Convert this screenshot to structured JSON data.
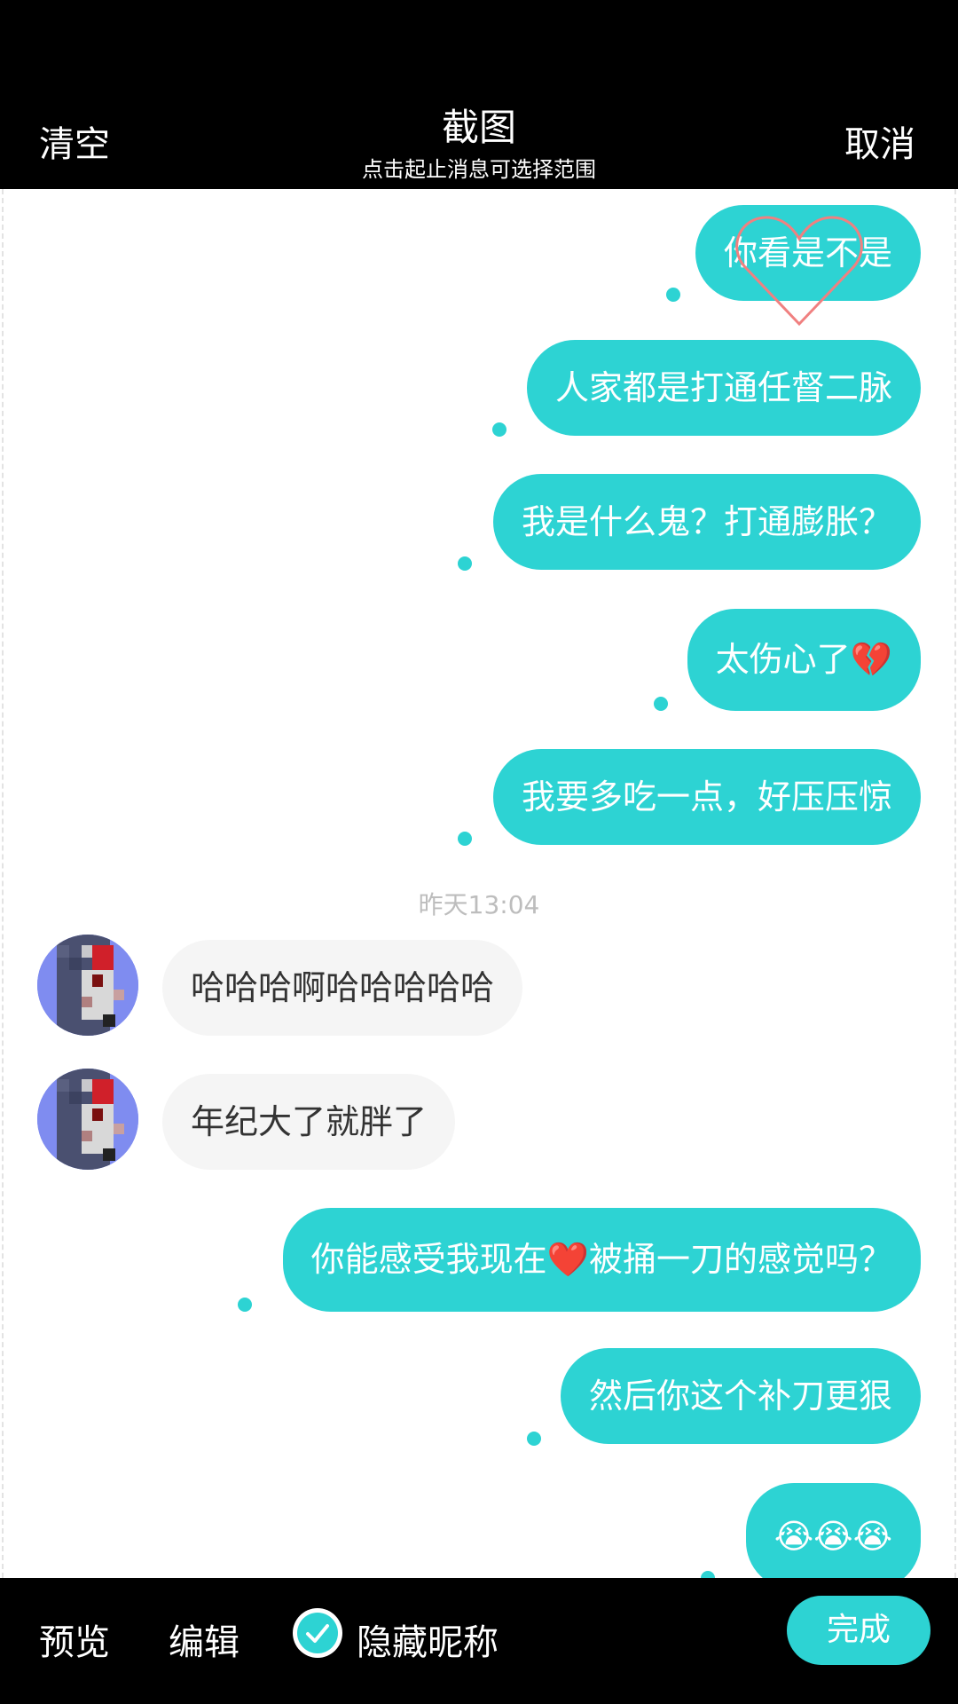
{
  "header": {
    "clear_label": "清空",
    "title": "截图",
    "subtitle": "点击起止消息可选择范围",
    "cancel_label": "取消"
  },
  "messages": [
    {
      "side": "out",
      "text": "你看是不是",
      "decor": "heart-outline-icon"
    },
    {
      "side": "out",
      "text": "人家都是打通任督二脉"
    },
    {
      "side": "out",
      "text": "我是什么鬼？打通膨胀？"
    },
    {
      "side": "out",
      "text": "太伤心了💔"
    },
    {
      "side": "out",
      "text": "我要多吃一点，好压压惊"
    },
    {
      "side": "in",
      "text": "哈哈哈啊哈哈哈哈哈"
    },
    {
      "side": "in",
      "text": "年纪大了就胖了"
    },
    {
      "side": "out",
      "text": "你能感受我现在❤️被捅一刀的感觉吗？"
    },
    {
      "side": "out",
      "text": "然后你这个补刀更狠"
    },
    {
      "side": "out",
      "text": "😭😭😭"
    }
  ],
  "timestamp": "昨天13:04",
  "footer": {
    "preview_label": "预览",
    "edit_label": "编辑",
    "hide_nickname_label": "隐藏昵称",
    "hide_nickname_checked": true,
    "done_label": "完成"
  },
  "colors": {
    "accent": "#2dd3d3",
    "bar": "#000000",
    "incoming_bubble": "#f5f5f5",
    "heart_outline": "#f08080"
  }
}
